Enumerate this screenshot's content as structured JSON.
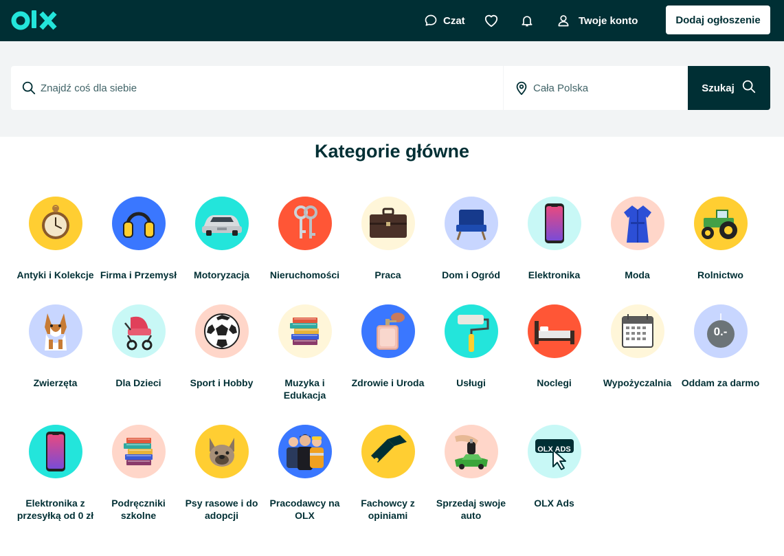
{
  "header": {
    "logo_text": "olx",
    "chat_label": "Czat",
    "account_label": "Twoje konto",
    "post_ad_label": "Dodaj ogłoszenie",
    "icons": [
      "chat-icon",
      "heart-icon",
      "bell-icon",
      "user-icon"
    ]
  },
  "search": {
    "query_placeholder": "Znajdź coś dla siebie",
    "location_placeholder": "Cała Polska",
    "button_label": "Szukaj"
  },
  "section_title": "Kategorie główne",
  "colors": {
    "brand_dark": "#002f34",
    "brand_teal": "#23e5db",
    "band_gray": "#f2f4f5"
  },
  "categories": [
    {
      "label": "Antyki i Kolekcje",
      "icon": "pocket-watch-icon",
      "bg": "#ffce32"
    },
    {
      "label": "Firma i Przemysł",
      "icon": "ear-defenders-icon",
      "bg": "#3a77ff"
    },
    {
      "label": "Motoryzacja",
      "icon": "car-icon",
      "bg": "#23e5db"
    },
    {
      "label": "Nieruchomości",
      "icon": "keys-icon",
      "bg": "#ff5636"
    },
    {
      "label": "Praca",
      "icon": "briefcase-icon",
      "bg": "#fff6d9"
    },
    {
      "label": "Dom i Ogród",
      "icon": "armchair-icon",
      "bg": "#c8d6ff"
    },
    {
      "label": "Elektronika",
      "icon": "smartphone-icon",
      "bg": "#c8f8f6"
    },
    {
      "label": "Moda",
      "icon": "dress-icon",
      "bg": "#ffd6c9"
    },
    {
      "label": "Rolnictwo",
      "icon": "tractor-icon",
      "bg": "#ffce32"
    },
    {
      "label": "Zwierzęta",
      "icon": "dog-icon",
      "bg": "#c8d6ff"
    },
    {
      "label": "Dla Dzieci",
      "icon": "stroller-icon",
      "bg": "#c8f8f6"
    },
    {
      "label": "Sport i Hobby",
      "icon": "soccer-ball-icon",
      "bg": "#ffd6c9"
    },
    {
      "label": "Muzyka i Edukacja",
      "icon": "books-icon",
      "bg": "#fff6d9"
    },
    {
      "label": "Zdrowie i Uroda",
      "icon": "perfume-icon",
      "bg": "#3a77ff"
    },
    {
      "label": "Usługi",
      "icon": "paint-roller-icon",
      "bg": "#23e5db"
    },
    {
      "label": "Noclegi",
      "icon": "bed-icon",
      "bg": "#ff5636"
    },
    {
      "label": "Wypożyczalnia",
      "icon": "calendar-icon",
      "bg": "#fff6d9"
    },
    {
      "label": "Oddam za darmo",
      "icon": "price-tag-icon",
      "bg": "#c8d6ff",
      "tag_text": "0.-"
    },
    {
      "label": "Elektronika z przesyłką od 0 zł",
      "icon": "smartphone-icon",
      "bg": "#23e5db"
    },
    {
      "label": "Podręczniki szkolne",
      "icon": "books-icon",
      "bg": "#ffd6c9"
    },
    {
      "label": "Psy rasowe i do adopcji",
      "icon": "bulldog-icon",
      "bg": "#ffce32"
    },
    {
      "label": "Pracodawcy na OLX",
      "icon": "workers-icon",
      "bg": "#3a77ff"
    },
    {
      "label": "Fachowcy z opiniami",
      "icon": "badge-icon",
      "bg": "#ffce32"
    },
    {
      "label": "Sprzedaj swoje auto",
      "icon": "car-key-icon",
      "bg": "#ffd6c9"
    },
    {
      "label": "OLX Ads",
      "icon": "olx-ads-icon",
      "bg": "#c8f8f6",
      "tag_text": "OLX ADS"
    }
  ]
}
